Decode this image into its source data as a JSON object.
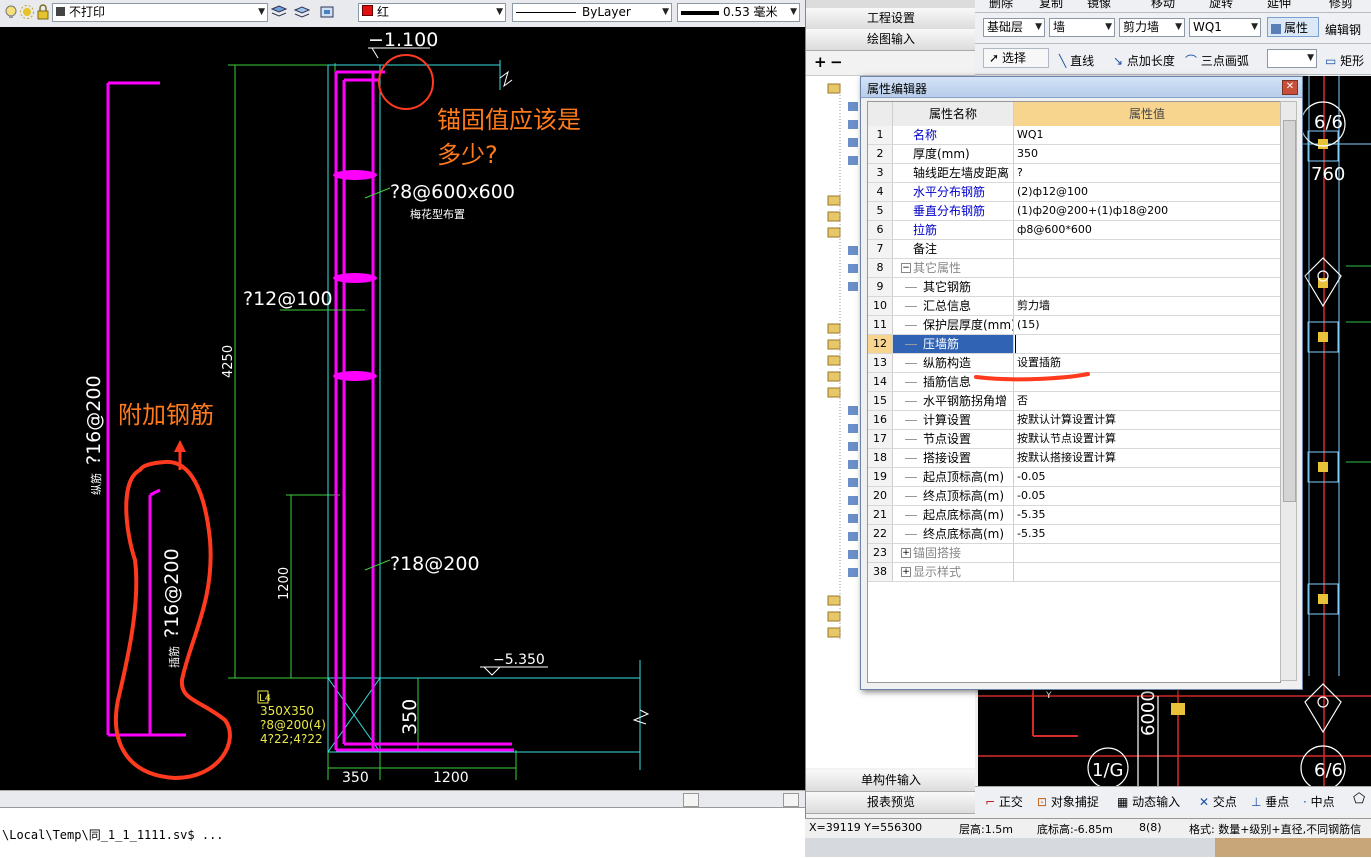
{
  "cad": {
    "toolbar": {
      "layer_value": "不打印",
      "color_value": "红",
      "color_hex": "#e01010",
      "linetype_value": "ByLayer",
      "lineweight_value": "0.53 毫米"
    },
    "canvas": {
      "top_elevation": "−1.100",
      "annotation_question": "锚固值应该是\n多少?",
      "annotation_rebar": "附加钢筋",
      "dim_tie": "?8@600x600",
      "dim_tie_note": "梅花型布置",
      "dim_horizontal": "?12@100",
      "dim_vertical": "?18@200",
      "dim_height_main": "4250",
      "dim_height_lower": "1200",
      "dim_350_vert": "350",
      "bottom_elevation": "−5.350",
      "dim_width_left": "350",
      "dim_width_right": "1200",
      "left_rebar_1": "?16@200",
      "left_rebar_1_prefix": "纵筋",
      "left_rebar_2": "?16@200",
      "left_rebar_2_prefix": "插筋",
      "beam_label": "L4",
      "beam_size": "350X350",
      "beam_stirrup": "?8@200(4)",
      "beam_bars": "4?22;4?22",
      "accent_magenta": "#ff00ff",
      "accent_red": "#ff3a1e",
      "annotation_orange": "#ff7a1a"
    },
    "cmdline": "\\Local\\Temp\\同_1_1_1111.sv$ ..."
  },
  "gld": {
    "left_buttons": [
      "工程设置",
      "绘图输入"
    ],
    "bottom_buttons": [
      "单构件输入",
      "报表预览"
    ],
    "toolbar1": [
      "删除",
      "复制",
      "镜像",
      "移动",
      "旋转",
      "延伸",
      "修剪"
    ],
    "toolbar2": {
      "floor": "基础层",
      "category": "墙",
      "type": "剪力墙",
      "name": "WQ1",
      "props_btn": "属性",
      "edit_btn": "编辑钢"
    },
    "toolbar3": [
      "选择",
      "直线",
      "点加长度",
      "三点画弧",
      "矩形"
    ],
    "canvas_labels": {
      "axis_top": "6/6",
      "dim_760": "760",
      "axis_bottom_left": "1/G",
      "axis_bottom_right": "6/6",
      "dim_6000": "6000"
    },
    "snap_buttons": [
      "正交",
      "对象捕捉",
      "动态输入",
      "交点",
      "垂点",
      "中点"
    ],
    "status": {
      "coords": "X=39119 Y=556300",
      "floor_height": "层高:1.5m",
      "bottom_elev": "底标高:-6.85m",
      "count": "8(8)",
      "format": "格式: 数量+级别+直径,不同钢筋信"
    }
  },
  "prop_dialog": {
    "title": "属性编辑器",
    "col_name": "属性名称",
    "col_value": "属性值",
    "rows": [
      {
        "num": "1",
        "name": "名称",
        "value": "WQ1",
        "blue": true
      },
      {
        "num": "2",
        "name": "厚度(mm)",
        "value": "350"
      },
      {
        "num": "3",
        "name": "轴线距左墙皮距离",
        "value": "?"
      },
      {
        "num": "4",
        "name": "水平分布钢筋",
        "value": "(2)ф12@100",
        "blue": true
      },
      {
        "num": "5",
        "name": "垂直分布钢筋",
        "value": "(1)ф20@200+(1)ф18@200",
        "blue": true
      },
      {
        "num": "6",
        "name": "拉筋",
        "value": "ф8@600*600",
        "blue": true
      },
      {
        "num": "7",
        "name": "备注",
        "value": ""
      },
      {
        "num": "8",
        "name": "其它属性",
        "value": "",
        "group": true
      },
      {
        "num": "9",
        "name": "其它钢筋",
        "value": "",
        "child": true
      },
      {
        "num": "10",
        "name": "汇总信息",
        "value": "剪力墙",
        "child": true
      },
      {
        "num": "11",
        "name": "保护层厚度(mm)",
        "value": "(15)",
        "child": true
      },
      {
        "num": "12",
        "name": "压墙筋",
        "value": "",
        "child": true,
        "selected": true
      },
      {
        "num": "13",
        "name": "纵筋构造",
        "value": "设置插筋",
        "child": true
      },
      {
        "num": "14",
        "name": "插筋信息",
        "value": "",
        "child": true
      },
      {
        "num": "15",
        "name": "水平钢筋拐角增",
        "value": "否",
        "child": true
      },
      {
        "num": "16",
        "name": "计算设置",
        "value": "按默认计算设置计算",
        "child": true
      },
      {
        "num": "17",
        "name": "节点设置",
        "value": "按默认节点设置计算",
        "child": true
      },
      {
        "num": "18",
        "name": "搭接设置",
        "value": "按默认搭接设置计算",
        "child": true
      },
      {
        "num": "19",
        "name": "起点顶标高(m)",
        "value": "-0.05",
        "child": true
      },
      {
        "num": "20",
        "name": "终点顶标高(m)",
        "value": "-0.05",
        "child": true
      },
      {
        "num": "21",
        "name": "起点底标高(m)",
        "value": "-5.35",
        "child": true
      },
      {
        "num": "22",
        "name": "终点底标高(m)",
        "value": "-5.35",
        "child": true
      },
      {
        "num": "23",
        "name": "锚固搭接",
        "value": "",
        "group": true,
        "collapsed": true
      },
      {
        "num": "38",
        "name": "显示样式",
        "value": "",
        "group": true,
        "collapsed": true
      }
    ]
  }
}
